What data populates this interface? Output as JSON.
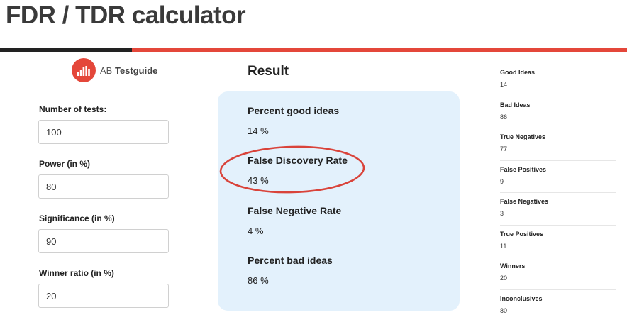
{
  "page": {
    "title": "FDR / TDR calculator"
  },
  "logo": {
    "prefix": "AB",
    "name": "Testguide"
  },
  "inputs": [
    {
      "label": "Number of tests:",
      "value": "100"
    },
    {
      "label": "Power (in %)",
      "value": "80"
    },
    {
      "label": "Significance (in %)",
      "value": "90"
    },
    {
      "label": "Winner ratio (in %)",
      "value": "20"
    }
  ],
  "result": {
    "heading": "Result",
    "metrics": [
      {
        "label": "Percent good ideas",
        "value": "14 %"
      },
      {
        "label": "False Discovery Rate",
        "value": "43 %"
      },
      {
        "label": "False Negative Rate",
        "value": "4 %"
      },
      {
        "label": "Percent bad ideas",
        "value": "86 %"
      }
    ]
  },
  "stats": [
    {
      "label": "Good Ideas",
      "value": "14"
    },
    {
      "label": "Bad Ideas",
      "value": "86"
    },
    {
      "label": "True Negatives",
      "value": "77"
    },
    {
      "label": "False Positives",
      "value": "9"
    },
    {
      "label": "False Negatives",
      "value": "3"
    },
    {
      "label": "True Positives",
      "value": "11"
    },
    {
      "label": "Winners",
      "value": "20"
    },
    {
      "label": "Inconclusives",
      "value": "80"
    }
  ],
  "colors": {
    "accent": "#e4473a",
    "panel": "#e3f1fc",
    "rule_dark": "#222222"
  }
}
